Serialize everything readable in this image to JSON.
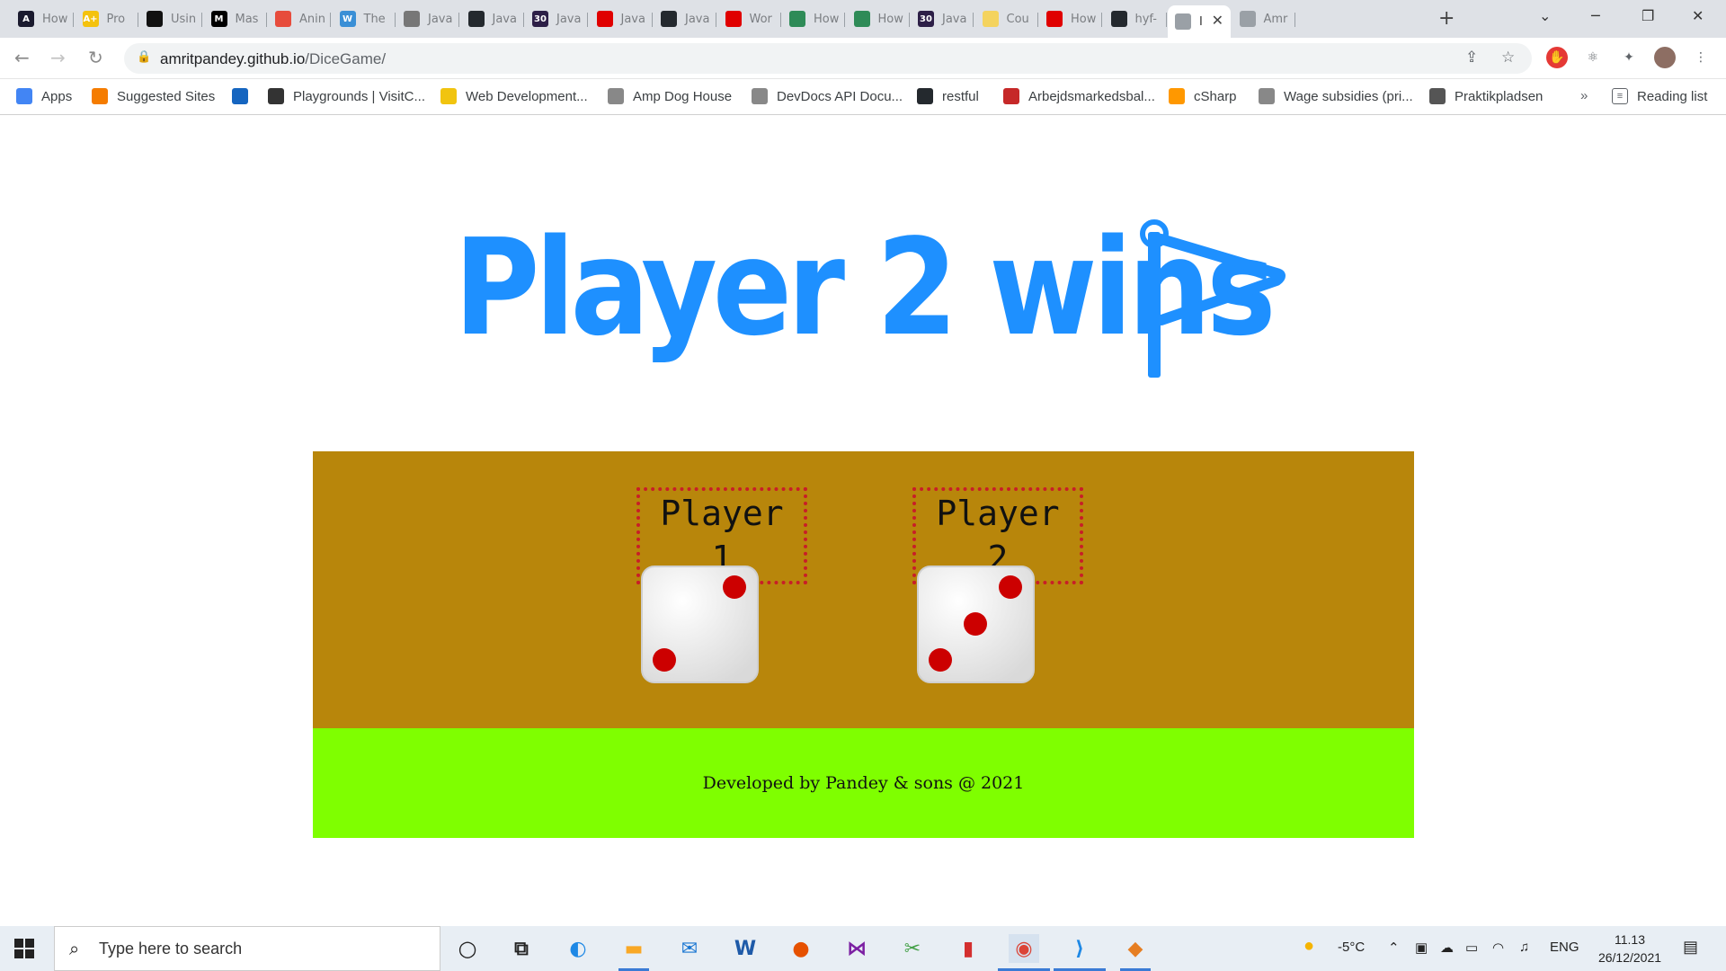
{
  "browser": {
    "tabs": [
      {
        "title": "How",
        "fav": "A",
        "color": "#1a1a2e"
      },
      {
        "title": "Pro",
        "fav": "A+",
        "color": "#f4c20d"
      },
      {
        "title": "Usin",
        "fav": "",
        "color": "#111111"
      },
      {
        "title": "Mas",
        "fav": "M",
        "color": "#000000"
      },
      {
        "title": "Anin",
        "fav": "",
        "color": "#e74c3c"
      },
      {
        "title": "The",
        "fav": "W",
        "color": "#3a8fd6"
      },
      {
        "title": "Java",
        "fav": "",
        "color": "#777777"
      },
      {
        "title": "Java",
        "fav": "",
        "color": "#24292e"
      },
      {
        "title": "Java",
        "fav": "30",
        "color": "#2d1f47"
      },
      {
        "title": "Java",
        "fav": "",
        "color": "#e00000"
      },
      {
        "title": "Java",
        "fav": "",
        "color": "#24292e"
      },
      {
        "title": "Wor",
        "fav": "",
        "color": "#e00000"
      },
      {
        "title": "How",
        "fav": "",
        "color": "#2e8b57"
      },
      {
        "title": "How",
        "fav": "",
        "color": "#2e8b57"
      },
      {
        "title": "Java",
        "fav": "30",
        "color": "#2d1f47"
      },
      {
        "title": "Cou",
        "fav": "",
        "color": "#f4d35e"
      },
      {
        "title": "How",
        "fav": "",
        "color": "#e00000"
      },
      {
        "title": "hyf-",
        "fav": "",
        "color": "#24292e"
      },
      {
        "title": "I",
        "fav": "",
        "color": "#9aa0a6"
      },
      {
        "title": "Amr",
        "fav": "",
        "color": "#9aa0a6"
      }
    ],
    "new_tab": "+",
    "url_host": "amritpandey.github.io",
    "url_path": "/DiceGame/"
  },
  "bookmarks": [
    {
      "label": "Apps",
      "color": "#4285f4"
    },
    {
      "label": "Suggested Sites",
      "color": "#f57c00"
    },
    {
      "label": "",
      "color": "#1565c0"
    },
    {
      "label": "Playgrounds | VisitC...",
      "color": "#333333"
    },
    {
      "label": "Web Development...",
      "color": "#f1c40f"
    },
    {
      "label": "Amp Dog House",
      "color": "#888888"
    },
    {
      "label": "DevDocs API Docu...",
      "color": "#888888"
    },
    {
      "label": "restful",
      "color": "#24292e"
    },
    {
      "label": "Arbejdsmarkedsbal...",
      "color": "#c62828"
    },
    {
      "label": "cSharp",
      "color": "#ff9800"
    },
    {
      "label": "Wage subsidies (pri...",
      "color": "#888888"
    },
    {
      "label": "Praktikpladsen",
      "color": "#555555"
    }
  ],
  "reading_list": "Reading list",
  "bookmarks_more": "»",
  "page": {
    "heading": "Player 2 wins",
    "player1_label": "Player 1",
    "player2_label": "Player 2",
    "player1_die": 2,
    "player2_die": 3,
    "footer": "Developed by Pandey & sons @ 2021",
    "colors": {
      "heading": "#1e90ff",
      "game_bg": "#b8860b",
      "footer_bg": "#7fff00",
      "pip": "#cc0000",
      "label_border": "#c81e28"
    }
  },
  "taskbar": {
    "search_placeholder": "Type here to search",
    "temperature": "-5°C",
    "language": "ENG",
    "time": "11.13",
    "date": "26/12/2021"
  }
}
